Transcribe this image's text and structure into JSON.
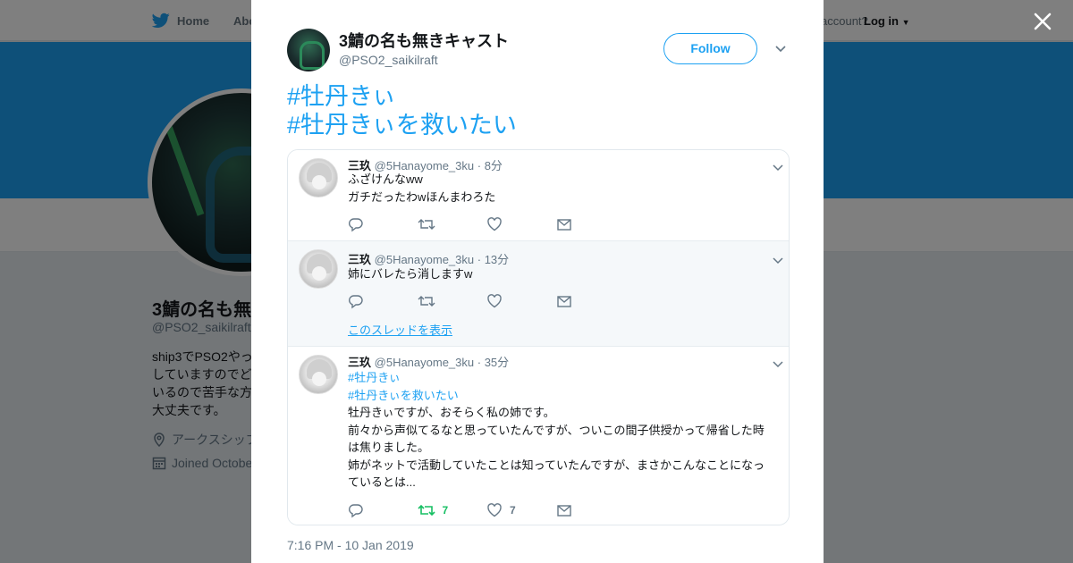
{
  "background": {
    "nav": {
      "home_label": "Home",
      "about_label": "Abo",
      "account_text": "account?",
      "login_label": "Log in"
    },
    "profile": {
      "name": "3鯖の名も無",
      "handle": "@PSO2_saikilraft",
      "bio": "ship3でPSO2やっ\nしていますのでど\nいるので苦手な方\n大丈夫です。",
      "location": "アークスシップ",
      "joined": "Joined Octobe"
    }
  },
  "modal": {
    "author": {
      "name": "3鯖の名も無きキャスト",
      "handle": "@PSO2_saikilraft"
    },
    "follow_label": "Follow",
    "tweet_lines": [
      "#牡丹きぃ",
      "#牡丹きぃを救いたい"
    ],
    "timestamp": "7:16 PM - 10 Jan 2019",
    "replies": [
      {
        "name": "三玖",
        "handle": "@5Hanayome_3ku",
        "time": "· 8分",
        "lines": [
          "ふざけんなww",
          "ガチだったわwほんまわろた"
        ],
        "retweets": "",
        "likes": ""
      },
      {
        "name": "三玖",
        "handle": "@5Hanayome_3ku",
        "time": "· 13分",
        "lines": [
          "姉にバレたら消しますw"
        ],
        "thread_link": "このスレッドを表示",
        "retweets": "",
        "likes": ""
      },
      {
        "name": "三玖",
        "handle": "@5Hanayome_3ku",
        "time": "· 35分",
        "tags": [
          "#牡丹きぃ",
          "#牡丹きぃを救いたい"
        ],
        "lines": [
          "牡丹きぃですが、おそらく私の姉です。",
          "前々から声似てるなと思っていたんですが、ついこの間子供授かって帰省した時",
          "は焦りました。",
          "姉がネットで活動していたことは知っていたんですが、まさかこんなことになっ",
          "ているとは..."
        ],
        "retweets": "7",
        "likes": "7"
      }
    ]
  },
  "colors": {
    "accent": "#1da1f2",
    "retweet_active": "#17bf63",
    "overlay": "rgba(0,0,0,0.5)"
  },
  "icons": [
    "twitter-bird-icon",
    "close-icon",
    "chevron-down-icon",
    "reply-icon",
    "retweet-icon",
    "like-icon",
    "message-icon",
    "location-icon",
    "calendar-icon"
  ]
}
